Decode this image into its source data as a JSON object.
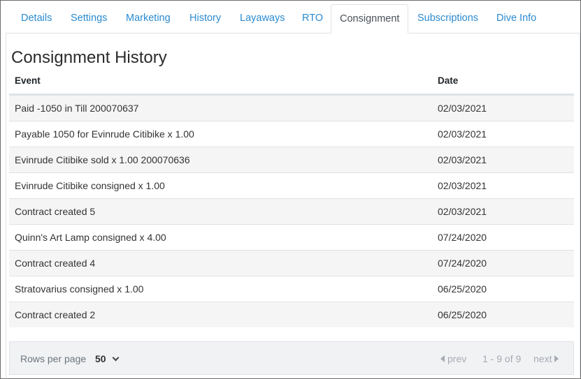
{
  "tabs": [
    {
      "label": "Details"
    },
    {
      "label": "Settings"
    },
    {
      "label": "Marketing"
    },
    {
      "label": "History"
    },
    {
      "label": "Layaways"
    },
    {
      "label": "RTO"
    },
    {
      "label": "Consignment"
    },
    {
      "label": "Subscriptions"
    },
    {
      "label": "Dive Info"
    }
  ],
  "active_tab": "Consignment",
  "title": "Consignment History",
  "columns": {
    "event": "Event",
    "date": "Date"
  },
  "rows": [
    {
      "event": "Paid -1050 in Till 200070637",
      "date": "02/03/2021"
    },
    {
      "event": "Payable 1050 for Evinrude Citibike x 1.00",
      "date": "02/03/2021"
    },
    {
      "event": "Evinrude Citibike sold x 1.00 200070636",
      "date": "02/03/2021"
    },
    {
      "event": "Evinrude Citibike consigned x 1.00",
      "date": "02/03/2021"
    },
    {
      "event": "Contract created 5",
      "date": "02/03/2021"
    },
    {
      "event": "Quinn's Art Lamp consigned x 4.00",
      "date": "07/24/2020"
    },
    {
      "event": "Contract created 4",
      "date": "07/24/2020"
    },
    {
      "event": "Stratovarius consigned x 1.00",
      "date": "06/25/2020"
    },
    {
      "event": "Contract created 2",
      "date": "06/25/2020"
    }
  ],
  "footer": {
    "rows_per_page_label": "Rows per page",
    "rows_per_page_value": "50",
    "prev_label": "prev",
    "range_label": "1 - 9 of 9",
    "next_label": "next"
  }
}
